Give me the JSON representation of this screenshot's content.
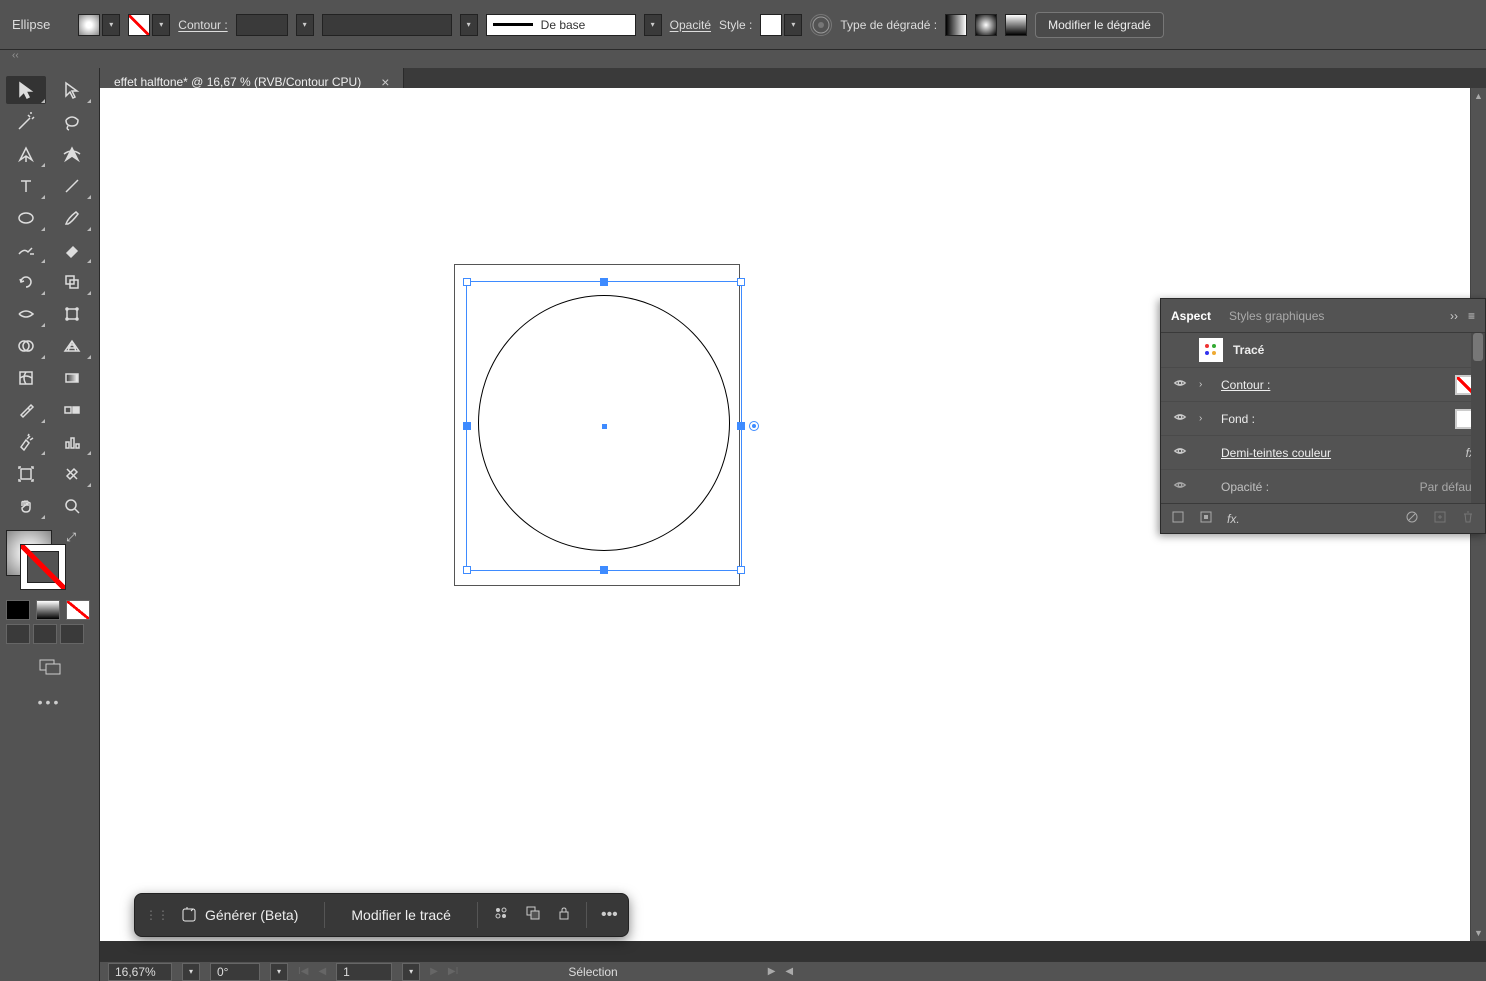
{
  "topbar": {
    "shape_label": "Ellipse",
    "contour_label": "Contour :",
    "stroke_style_label": "De base",
    "opacity_label": "Opacité",
    "style_label": "Style :",
    "gradient_type_label": "Type de dégradé :",
    "modify_gradient_label": "Modifier le dégradé"
  },
  "tab": {
    "title": "effet halftone* @ 16,67 % (RVB/Contour CPU)"
  },
  "ctx": {
    "generate_label": "Générer (Beta)",
    "edit_path_label": "Modifier le tracé"
  },
  "panel": {
    "tab_aspect": "Aspect",
    "tab_graphic_styles": "Styles graphiques",
    "trace_label": "Tracé",
    "contour_label": "Contour :",
    "fond_label": "Fond :",
    "halftone_label": "Demi-teintes couleur",
    "opacity_label": "Opacité :",
    "opacity_value": "Par défaut",
    "fx_label": "fx."
  },
  "status": {
    "zoom": "16,67%",
    "rotation": "0°",
    "artboard": "1",
    "selection_label": "Sélection"
  }
}
